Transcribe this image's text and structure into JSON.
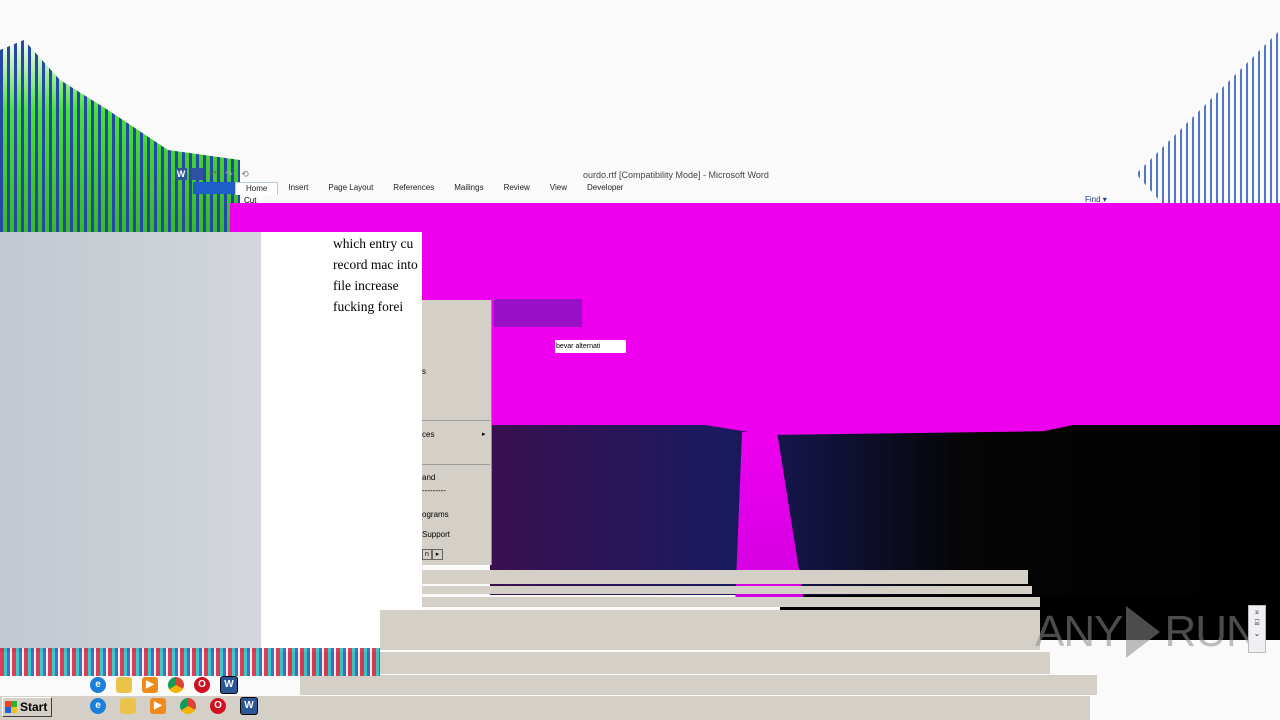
{
  "window": {
    "title": "ourdo.rtf [Compatibility Mode] - Microsoft Word"
  },
  "qat": {
    "word_icon": "W",
    "undo_icon": "↶",
    "redo_icon": "↷",
    "repeat_icon": "⟲"
  },
  "ribbon": {
    "tabs": [
      "",
      "Home",
      "Insert",
      "Page Layout",
      "References",
      "Mailings",
      "Review",
      "View",
      "Developer"
    ],
    "cut_label": "Cut",
    "find_label": "Find ▾"
  },
  "document": {
    "lines": [
      "which entry cu",
      "record mac into",
      "file increase",
      "fucking forei"
    ]
  },
  "tooltip": {
    "text": "bevar alternati"
  },
  "start_menu": {
    "items": [
      "s",
      "ces",
      "and",
      "---------",
      "ograms",
      "Support"
    ],
    "arrow": "▸",
    "btn_a": "n",
    "btn_b": "▸"
  },
  "watermark": {
    "left": "ANY",
    "right": "RUN"
  },
  "scroll_widget": {
    "lines": [
      "⌅",
      "⌸",
      "⌄"
    ]
  },
  "taskbar": {
    "start_label": "Start",
    "quicklaunch": [
      {
        "icon": "ie-icon",
        "glyph": "e"
      },
      {
        "icon": "folder-icon",
        "glyph": ""
      },
      {
        "icon": "media-player-icon",
        "glyph": "▶"
      },
      {
        "icon": "chrome-icon",
        "glyph": ""
      },
      {
        "icon": "opera-icon",
        "glyph": "O"
      },
      {
        "icon": "word-icon",
        "glyph": "W"
      }
    ]
  },
  "colors": {
    "glitch_magenta": "#ee00ee",
    "glitch_purple": "#9a10c8",
    "word_blue": "#2b5797",
    "taskbar_grey": "#d4d0c8"
  }
}
